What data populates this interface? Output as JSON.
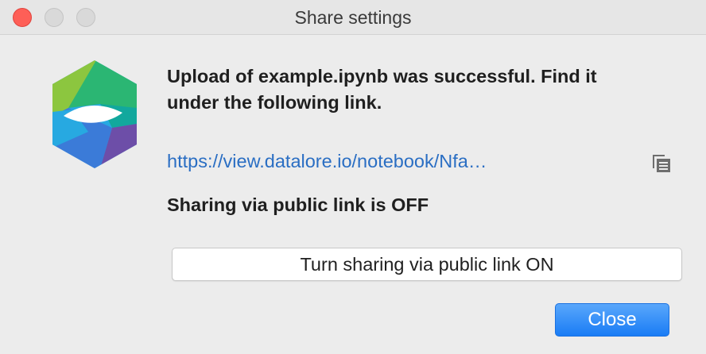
{
  "window": {
    "title": "Share settings"
  },
  "logo": {
    "icon": "datalore-logo-icon",
    "colors": {
      "green_light": "#8cc63f",
      "green": "#2bb673",
      "teal": "#12a89d",
      "blue": "#27a9e1",
      "blue_dark": "#3b7bd8",
      "purple": "#6d4ea8"
    }
  },
  "message": {
    "line1": "Upload of example.ipynb was successful. Find it",
    "line2": "under the following link."
  },
  "link": {
    "text": "https://view.datalore.io/notebook/Nfa…",
    "color": "#2a6ec3"
  },
  "copy": {
    "icon": "copy-icon"
  },
  "sharing": {
    "status_text": "Sharing via public link is OFF",
    "toggle_label": "Turn sharing via public link ON"
  },
  "actions": {
    "close_label": "Close",
    "accent": "#1a7cf5"
  }
}
